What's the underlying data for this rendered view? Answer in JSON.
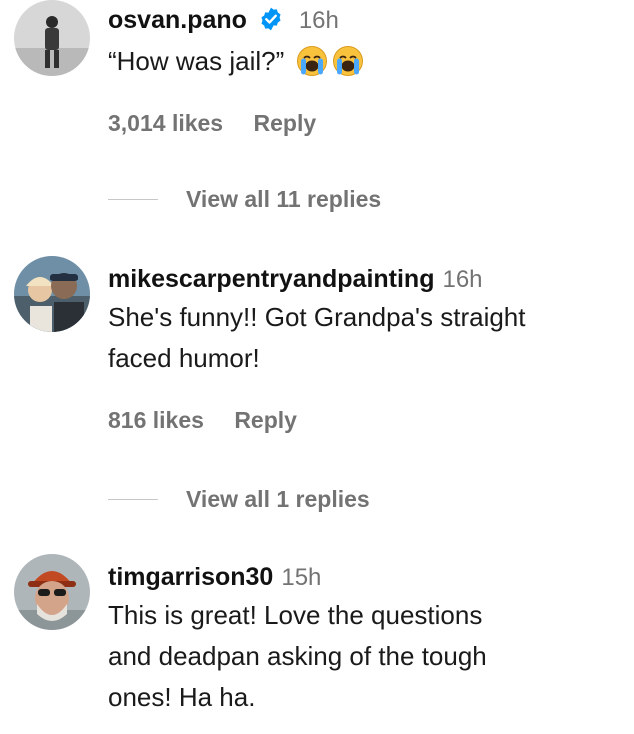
{
  "comments": [
    {
      "username": "osvan.pano",
      "verified": true,
      "time": "16h",
      "text": "“How was jail?”",
      "emojis": [
        "loudly-crying-face",
        "loudly-crying-face"
      ],
      "likes": "3,014 likes",
      "reply_label": "Reply",
      "view_replies": "View all 11 replies"
    },
    {
      "username": "mikescarpentryandpainting",
      "verified": false,
      "time": "16h",
      "text_lines": [
        "She's funny!! Got Grandpa's straight",
        "faced humor!"
      ],
      "likes": "816 likes",
      "reply_label": "Reply",
      "view_replies": "View all 1 replies"
    },
    {
      "username": "timgarrison30",
      "verified": false,
      "time": "15h",
      "text_lines": [
        "This is great! Love the questions",
        "and deadpan asking of the tough",
        "ones! Ha ha."
      ]
    }
  ],
  "colors": {
    "verified_blue": "#0095f6",
    "meta_gray": "#737373"
  }
}
